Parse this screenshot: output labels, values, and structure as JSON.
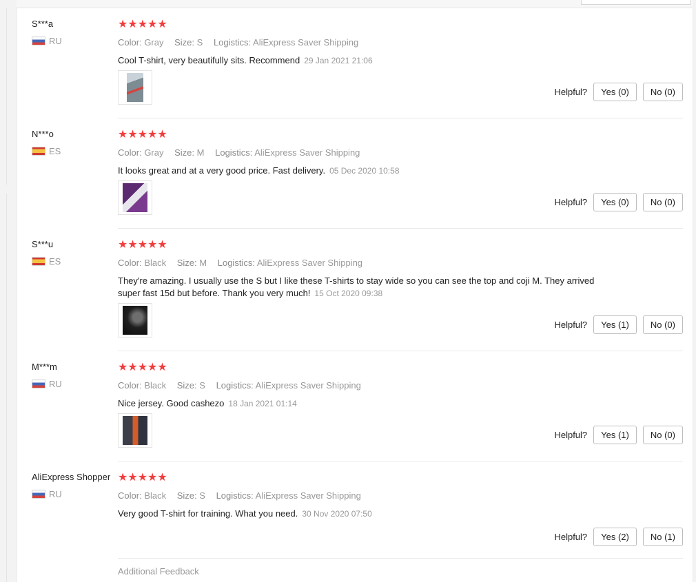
{
  "helpful_label": "Helpful?",
  "additional_feedback": "Additional Feedback",
  "labels": {
    "color": "Color:",
    "size": "Size:",
    "logistics": "Logistics:"
  },
  "reviews": [
    {
      "user": "S***a",
      "country": "RU",
      "stars": "★★★★★",
      "color": "Gray",
      "size": "S",
      "logistics": "AliExpress Saver Shipping",
      "text": "Cool T-shirt, very beautifully sits. Recommend",
      "date": "29 Jan 2021 21:06",
      "yes": "Yes (0)",
      "no": "No (0)"
    },
    {
      "user": "N***o",
      "country": "ES",
      "stars": "★★★★★",
      "color": "Gray",
      "size": "M",
      "logistics": "AliExpress Saver Shipping",
      "text": "It looks great and at a very good price. Fast delivery.",
      "date": "05 Dec 2020 10:58",
      "yes": "Yes (0)",
      "no": "No (0)"
    },
    {
      "user": "S***u",
      "country": "ES",
      "stars": "★★★★★",
      "color": "Black",
      "size": "M",
      "logistics": "AliExpress Saver Shipping",
      "text": "They're amazing. I usually use the S but I like these T-shirts to stay wide so you can see the top and coji M. They arrived super fast 15d but before. Thank you very much!",
      "date": "15 Oct 2020 09:38",
      "yes": "Yes (1)",
      "no": "No (0)"
    },
    {
      "user": "M***m",
      "country": "RU",
      "stars": "★★★★★",
      "color": "Black",
      "size": "S",
      "logistics": "AliExpress Saver Shipping",
      "text": "Nice jersey. Good cashezo",
      "date": "18 Jan 2021 01:14",
      "yes": "Yes (1)",
      "no": "No (0)"
    },
    {
      "user": "AliExpress Shopper",
      "country": "RU",
      "stars": "★★★★★",
      "color": "Black",
      "size": "S",
      "logistics": "AliExpress Saver Shipping",
      "text": "Very good T-shirt for training. What you need.",
      "date": "30 Nov 2020 07:50",
      "yes": "Yes (2)",
      "no": "No (1)"
    }
  ]
}
